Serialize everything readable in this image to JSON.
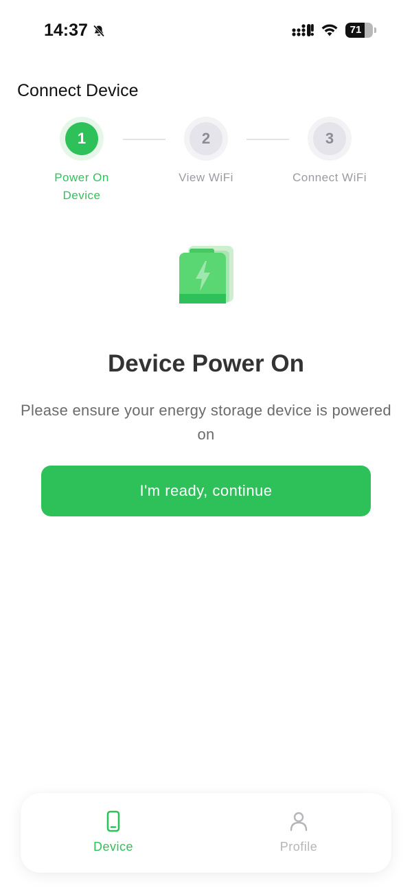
{
  "status_bar": {
    "time": "14:37",
    "battery_level": "71",
    "battery_fraction": 0.71,
    "icons": [
      "bell-slash-icon",
      "cellular-signal-icon",
      "wifi-icon",
      "battery-icon"
    ]
  },
  "header": {
    "title": "Connect Device"
  },
  "stepper": {
    "current_step": 1,
    "steps": [
      {
        "number": "1",
        "label_line1": "Power On",
        "label_line2": "Device",
        "state": "active"
      },
      {
        "number": "2",
        "label_line1": "View WiFi",
        "label_line2": "",
        "state": "inactive"
      },
      {
        "number": "3",
        "label_line1": "Connect WiFi",
        "label_line2": "",
        "state": "inactive"
      }
    ]
  },
  "main": {
    "illustration_icon": "battery-charging-icon",
    "heading": "Device Power On",
    "description": "Please ensure your energy storage device is powered on",
    "continue_label": "I'm ready, continue"
  },
  "tab_bar": {
    "tabs": [
      {
        "label": "Device",
        "icon": "phone-icon",
        "state": "active"
      },
      {
        "label": "Profile",
        "icon": "person-icon",
        "state": "inactive"
      }
    ]
  },
  "colors": {
    "accent": "#2ec15a",
    "accent_light": "#e6f7ea",
    "inactive_text": "#9a9aa2",
    "heading_text": "#333333",
    "body_text": "#6a6a6a"
  }
}
